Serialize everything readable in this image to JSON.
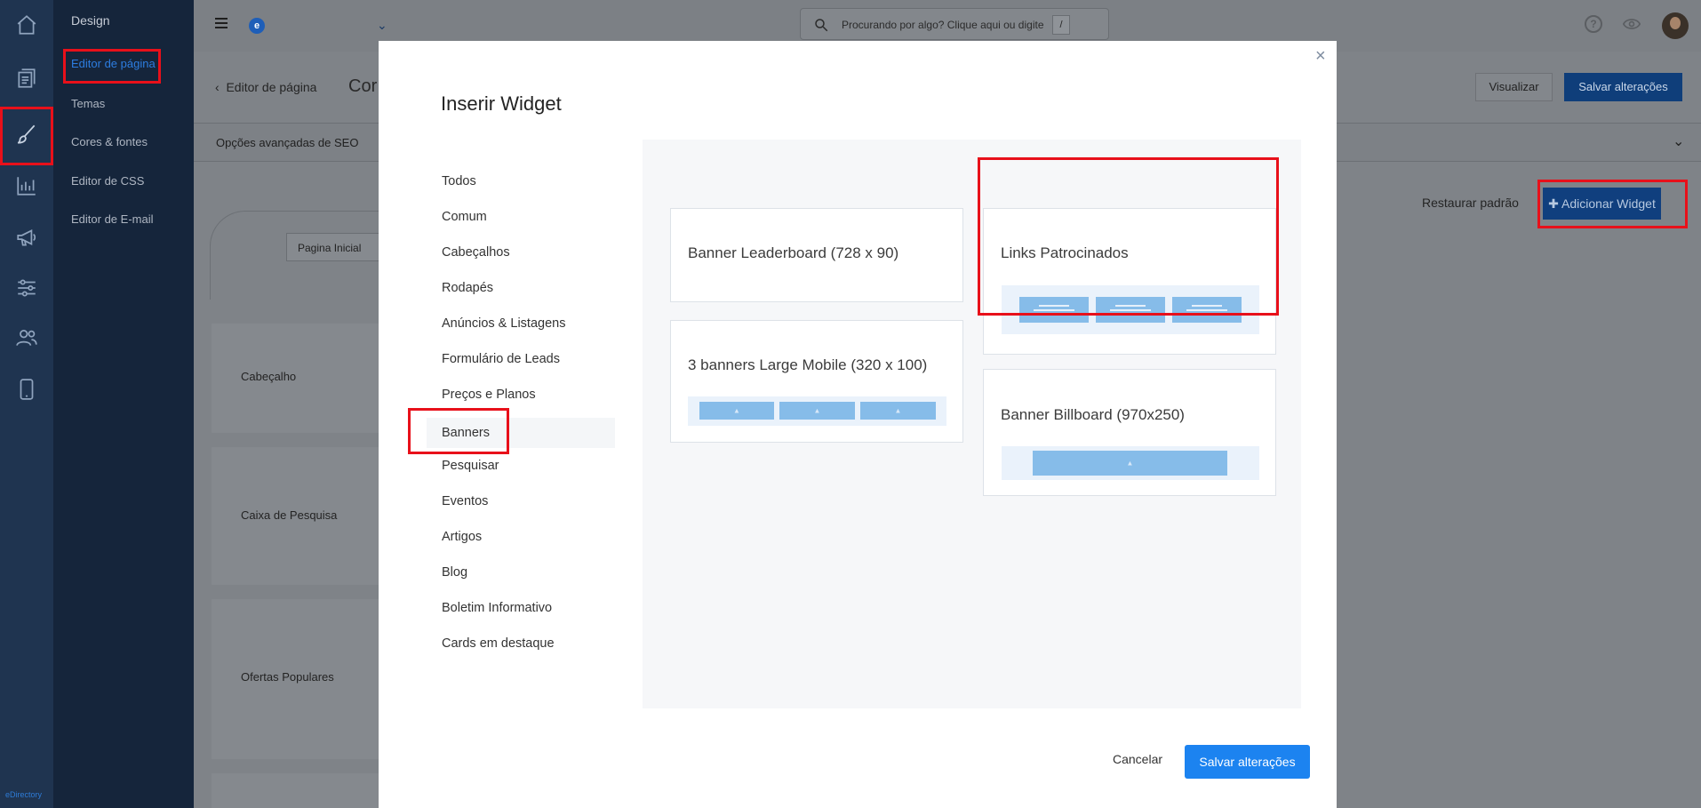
{
  "brand_footer": "eDirectory",
  "rail_icons": [
    "home-icon",
    "pages-icon",
    "brush-icon",
    "chart-icon",
    "megaphone-icon",
    "sliders-icon",
    "users-icon",
    "mobile-icon"
  ],
  "subnav": {
    "title": "Design",
    "items": [
      "Editor de página",
      "Temas",
      "Cores & fontes",
      "Editor de CSS",
      "Editor de E-mail"
    ]
  },
  "topbar": {
    "logo_letter": "e",
    "search_placeholder": "Procurando por algo? Clique aqui ou digite",
    "search_shortcut": "/",
    "help_glyph": "?"
  },
  "page": {
    "back_label": "Editor de página",
    "heading": "Cor",
    "preview_label": "Visualizar",
    "save_label": "Salvar alterações",
    "seo_label": "Opções avançadas de SEO",
    "restore_label": "Restaurar padrão",
    "add_widget_label": "✚ Adicionar Widget",
    "page_tab": "Pagina Inicial",
    "sections": [
      "Cabeçalho",
      "Caixa de Pesquisa",
      "Ofertas Populares"
    ]
  },
  "modal": {
    "title": "Inserir Widget",
    "close_glyph": "×",
    "selected_category": "Banners",
    "categories": [
      "Todos",
      "Comum",
      "Cabeçalhos",
      "Rodapés",
      "Anúncios & Listagens",
      "Formulário de Leads",
      "Preços e Planos",
      "Banners",
      "Pesquisar",
      "Eventos",
      "Artigos",
      "Blog",
      "Boletim Informativo",
      "Cards em destaque"
    ],
    "widgets": [
      "Banner Leaderboard (728 x 90)",
      "Links Patrocinados",
      "3 banners Large Mobile (320 x 100)",
      "Banner Billboard (970x250)"
    ],
    "cancel_label": "Cancelar",
    "save_label": "Salvar alterações"
  },
  "colors": {
    "highlight": "#e8101a",
    "primary": "#1c83f0",
    "rail": "#1f3450",
    "preview_block": "#86bce9"
  }
}
